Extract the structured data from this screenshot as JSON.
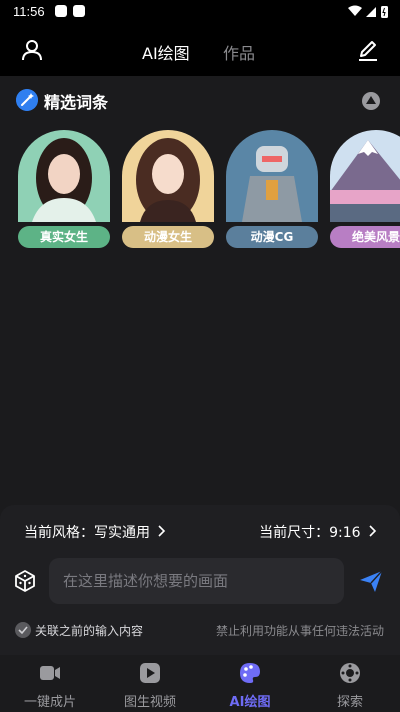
{
  "status_bar": {
    "time": "11:56"
  },
  "top_nav": {
    "tabs": [
      {
        "label": "AI绘图",
        "active": true
      },
      {
        "label": "作品",
        "active": false
      }
    ]
  },
  "section": {
    "title": "精选词条"
  },
  "cards": [
    {
      "label": "真实女生",
      "color": "#5db386"
    },
    {
      "label": "动漫女生",
      "color": "#d8bf86"
    },
    {
      "label": "动漫CG",
      "color": "#5b7f9c"
    },
    {
      "label": "绝美风景",
      "color": "#b87ec4"
    }
  ],
  "controls": {
    "style_label": "当前风格：写实通用",
    "size_label": "当前尺寸：9:16",
    "prompt_placeholder": "在这里描述你想要的画面",
    "checkbox_label": "关联之前的输入内容",
    "notice": "禁止利用功能从事任何违法活动"
  },
  "bottom_nav": [
    {
      "label": "一键成片",
      "icon": "video-icon",
      "active": false
    },
    {
      "label": "图生视频",
      "icon": "play-icon",
      "active": false
    },
    {
      "label": "AI绘图",
      "icon": "palette-icon",
      "active": true
    },
    {
      "label": "探索",
      "icon": "explore-icon",
      "active": false
    }
  ],
  "colors": {
    "accent": "#6f6cf6",
    "send": "#3b82f6"
  }
}
